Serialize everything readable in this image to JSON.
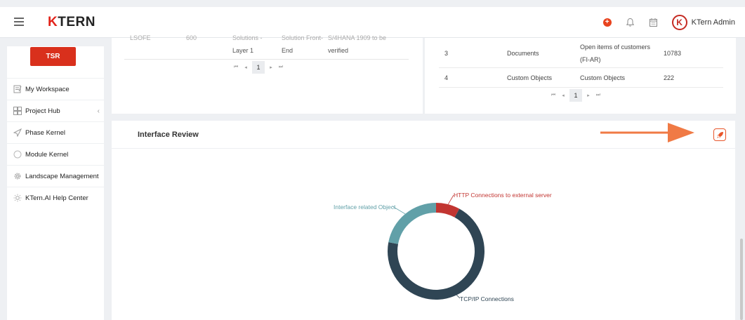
{
  "header": {
    "logo_k": "K",
    "logo_rest": "TERN",
    "user_initial": "K",
    "user_name": "KTern Admin"
  },
  "sidebar": {
    "tsr_label": "TSR",
    "items": [
      {
        "label": "My Workspace",
        "icon": "workspace-icon"
      },
      {
        "label": "Project Hub",
        "icon": "grid-icon"
      },
      {
        "label": "Phase Kernel",
        "icon": "send-icon"
      },
      {
        "label": "Module Kernel",
        "icon": "circle-icon"
      },
      {
        "label": "Landscape Management",
        "icon": "gear-icon"
      },
      {
        "label": "KTern.AI Help Center",
        "icon": "sun-icon"
      }
    ]
  },
  "left_table": {
    "row_partial": [
      "LSOFE",
      "600",
      "Solutions -",
      "Solution Front-",
      "S/4HANA 1909 to be"
    ],
    "row_main": [
      "Layer 1",
      "End",
      "verified"
    ],
    "page": "1"
  },
  "right_table": {
    "rows": [
      {
        "num": "3",
        "type": "Documents",
        "desc_line1": "Open items of customers",
        "desc_line2": "(FI-AR)",
        "count": "10783"
      },
      {
        "num": "4",
        "type": "Custom Objects",
        "desc_line1": "Custom Objects",
        "desc_line2": "",
        "count": "222"
      }
    ],
    "page": "1"
  },
  "review": {
    "title": "Interface Review"
  },
  "chart_data": {
    "type": "pie",
    "subtype": "donut",
    "categories": [
      "HTTP Connections to external server",
      "TCP/IP Connections",
      "Interface related Object"
    ],
    "values": [
      8,
      70,
      22
    ],
    "colors": [
      "#c23531",
      "#2f4554",
      "#61a0a8"
    ]
  }
}
